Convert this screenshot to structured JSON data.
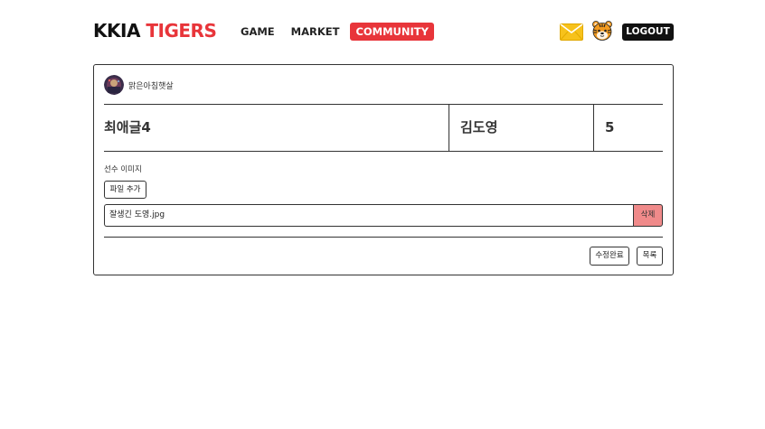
{
  "header": {
    "logo_part1": "KKIA",
    "logo_part2": "TIGERS",
    "nav": [
      {
        "label": "GAME",
        "active": false
      },
      {
        "label": "MARKET",
        "active": false
      },
      {
        "label": "COMMUNITY",
        "active": true
      }
    ],
    "mail_icon": "envelope-icon",
    "profile_icon": "tiger-face-icon",
    "logout_label": "LOGOUT"
  },
  "post": {
    "author": "맑은아침햇살",
    "title": "최애글4",
    "player": "김도영",
    "number": "5",
    "image_label": "선수 이미지",
    "add_file_label": "파일 추가",
    "file_name": "잘생긴 도영.jpg",
    "delete_label": "삭제",
    "save_label": "수정완료",
    "list_label": "목록"
  },
  "colors": {
    "brand_red": "#e8353a",
    "delete_pink": "#f08a8a",
    "border": "#333333"
  }
}
